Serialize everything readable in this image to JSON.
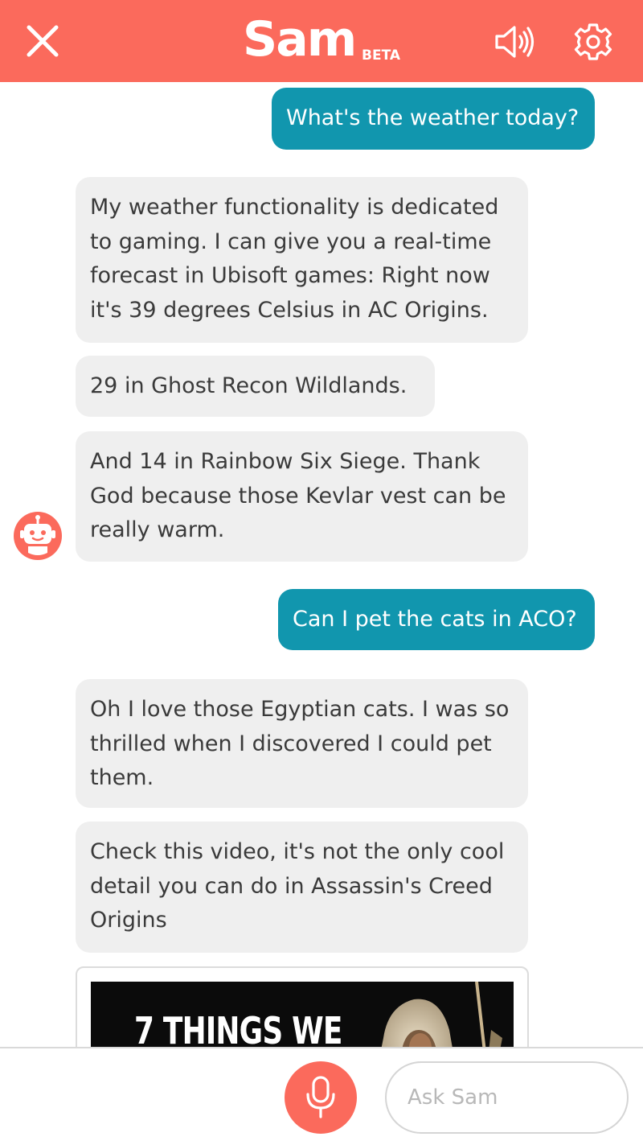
{
  "header": {
    "brand_name": "Sam",
    "brand_tag": "BETA",
    "background": "#fb6a5c",
    "icons": [
      "close-icon",
      "speaker-icon",
      "gear-icon"
    ]
  },
  "messages": [
    {
      "sender": "user",
      "text": "What's the weather today?"
    },
    {
      "sender": "bot",
      "lines": [
        "My weather functionality is dedicated",
        "to gaming. I can give you a real-time",
        "forecast in Ubisoft games: Right now",
        "it's 39 degrees Celsius in AC Origins."
      ]
    },
    {
      "sender": "bot",
      "lines": [
        "29 in Ghost Recon Wildlands."
      ]
    },
    {
      "sender": "bot",
      "lines": [
        "And 14 in Rainbow Six Siege. Thank",
        "God because those Kevlar vest can be",
        "really warm."
      ]
    },
    {
      "sender": "user",
      "text": "Can I pet the cats in ACO?"
    },
    {
      "sender": "bot",
      "lines": [
        "Oh I love those Egyptian cats. I was so",
        "thrilled when I discovered I could pet",
        "them."
      ]
    },
    {
      "sender": "bot",
      "lines": [
        "Check this video, it's not the only cool",
        "detail you can do in Assassin's Creed",
        "Origins"
      ]
    }
  ],
  "video_card": {
    "title": "7 THINGS WE"
  },
  "footer": {
    "input_placeholder": "Ask Sam",
    "icons": [
      "microphone-icon"
    ]
  },
  "colors": {
    "accent": "#fb6a5c",
    "user_bubble": "#1196ae",
    "bot_bubble": "#efefef",
    "bot_text": "#3a3a3a"
  }
}
